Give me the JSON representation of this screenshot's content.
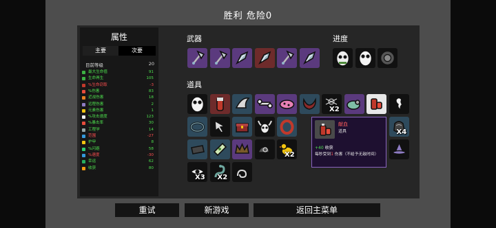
{
  "header": {
    "title": "胜利    危险0"
  },
  "stats": {
    "title": "属性",
    "tabs": [
      "主要",
      "次要"
    ],
    "level": {
      "label": "目前等级",
      "value": "20"
    },
    "rows": [
      {
        "label": "最大生命值",
        "value": "91",
        "color": "#4ee04e",
        "icon_color": "#3cb043"
      },
      {
        "label": "生命再生",
        "value": "105",
        "color": "#4ee04e",
        "icon_color": "#3cb043"
      },
      {
        "label": "%生命窃取",
        "value": "-3",
        "color": "#ff5050",
        "icon_color": "#c0392b"
      },
      {
        "label": "%伤害",
        "value": "83",
        "color": "#4ee04e",
        "icon_color": "#e74c3c"
      },
      {
        "label": "近战伤害",
        "value": "18",
        "color": "#4ee04e",
        "icon_color": "#e67e22"
      },
      {
        "label": "远程伤害",
        "value": "2",
        "color": "#4ee04e",
        "icon_color": "#8e7cc3"
      },
      {
        "label": "元素伤害",
        "value": "1",
        "color": "#4ee04e",
        "icon_color": "#f1c40f"
      },
      {
        "label": "%攻击速度",
        "value": "123",
        "color": "#4ee04e",
        "icon_color": "#ecf0f1"
      },
      {
        "label": "%暴击率",
        "value": "30",
        "color": "#4ee04e",
        "icon_color": "#e74c3c"
      },
      {
        "label": "工程学",
        "value": "14",
        "color": "#4ee04e",
        "icon_color": "#95a5a6"
      },
      {
        "label": "范围",
        "value": "-27",
        "color": "#ff5050",
        "icon_color": "#3498db"
      },
      {
        "label": "护甲",
        "value": "8",
        "color": "#4ee04e",
        "icon_color": "#f1c40f"
      },
      {
        "label": "%闪避",
        "value": "58",
        "color": "#4ee04e",
        "icon_color": "#2ecc71"
      },
      {
        "label": "%速度",
        "value": "-30",
        "color": "#ff5050",
        "icon_color": "#3498db"
      },
      {
        "label": "幸运",
        "value": "62",
        "color": "#4ee04e",
        "icon_color": "#27ae60"
      },
      {
        "label": "收获",
        "value": "80",
        "color": "#4ee04e",
        "icon_color": "#f39c12"
      }
    ]
  },
  "sections": {
    "weapons": "武器",
    "progress": "进度",
    "items": "道具"
  },
  "weapons": [
    {
      "icon": "axe-icon",
      "bg": "#5b3a7e"
    },
    {
      "icon": "axe-icon",
      "bg": "#5b3a7e"
    },
    {
      "icon": "gem-blade-icon",
      "bg": "#5b3a7e"
    },
    {
      "icon": "gem-blade-icon",
      "bg": "#6e2b2b"
    },
    {
      "icon": "axe-icon",
      "bg": "#5b3a7e"
    },
    {
      "icon": "gem-blade-icon",
      "bg": "#5b3a7e"
    }
  ],
  "progress": [
    {
      "icon": "skull-egg-icon"
    },
    {
      "icon": "egg-icon"
    },
    {
      "icon": "shield-icon"
    }
  ],
  "items": [
    {
      "icon": "egg-icon",
      "bg": "#111",
      "qty": ""
    },
    {
      "icon": "blood-vial-icon",
      "bg": "#6e2b2b",
      "qty": ""
    },
    {
      "icon": "claw-icon",
      "bg": "#2e4a5c",
      "qty": ""
    },
    {
      "icon": "bone-key-icon",
      "bg": "#5b3a7e",
      "qty": ""
    },
    {
      "icon": "pink-gem-icon",
      "bg": "#5b3a7e",
      "qty": ""
    },
    {
      "icon": "horns-icon",
      "bg": "#2e4a5c",
      "qty": ""
    },
    {
      "icon": "spider-icon",
      "bg": "#111",
      "qty": "X2"
    },
    {
      "icon": "green-blob-icon",
      "bg": "#5b3a7e",
      "qty": ""
    },
    {
      "icon": "blood-kit-icon",
      "bg": "#e8e8e8",
      "qty": ""
    },
    {
      "icon": "ghost-icon",
      "bg": "#111",
      "qty": ""
    },
    {
      "icon": "ring-icon",
      "bg": "#2e4a5c",
      "qty": ""
    },
    {
      "icon": "cursor-icon",
      "bg": "#111",
      "qty": ""
    },
    {
      "icon": "chest-icon",
      "bg": "#2e4a5c",
      "qty": ""
    },
    {
      "icon": "horned-skull-icon",
      "bg": "#111",
      "qty": ""
    },
    {
      "icon": "red-ring-icon",
      "bg": "#2e4a5c",
      "qty": ""
    },
    {
      "icon": "pouch-icon",
      "bg": "#2e4a5c",
      "qty": "X4"
    },
    {
      "icon": "slab-icon",
      "bg": "#2e4a5c",
      "qty": ""
    },
    {
      "icon": "scroll-icon",
      "bg": "#2e4a5c",
      "qty": ""
    },
    {
      "icon": "crown-icon",
      "bg": "#5b3a7e",
      "qty": ""
    },
    {
      "icon": "snail-icon",
      "bg": "#111",
      "qty": ""
    },
    {
      "icon": "duck-icon",
      "bg": "#111",
      "qty": "X2"
    },
    {
      "icon": "hat-icon",
      "bg": "#111",
      "qty": ""
    },
    {
      "icon": "eye-icon",
      "bg": "#111",
      "qty": "X3"
    },
    {
      "icon": "snake-icon",
      "bg": "#111",
      "qty": "X2"
    },
    {
      "icon": "coil-icon",
      "bg": "#111",
      "qty": ""
    }
  ],
  "tooltip": {
    "name": "献血",
    "type": "道具",
    "line1_value": "+40",
    "line1_text": " 收获",
    "line2_prefix": "每秒受到",
    "line2_value": "1",
    "line2_suffix": " 伤害（不给予无敌时间）"
  },
  "buttons": {
    "retry": "重试",
    "new_game": "新游戏",
    "main_menu": "返回主菜单"
  }
}
